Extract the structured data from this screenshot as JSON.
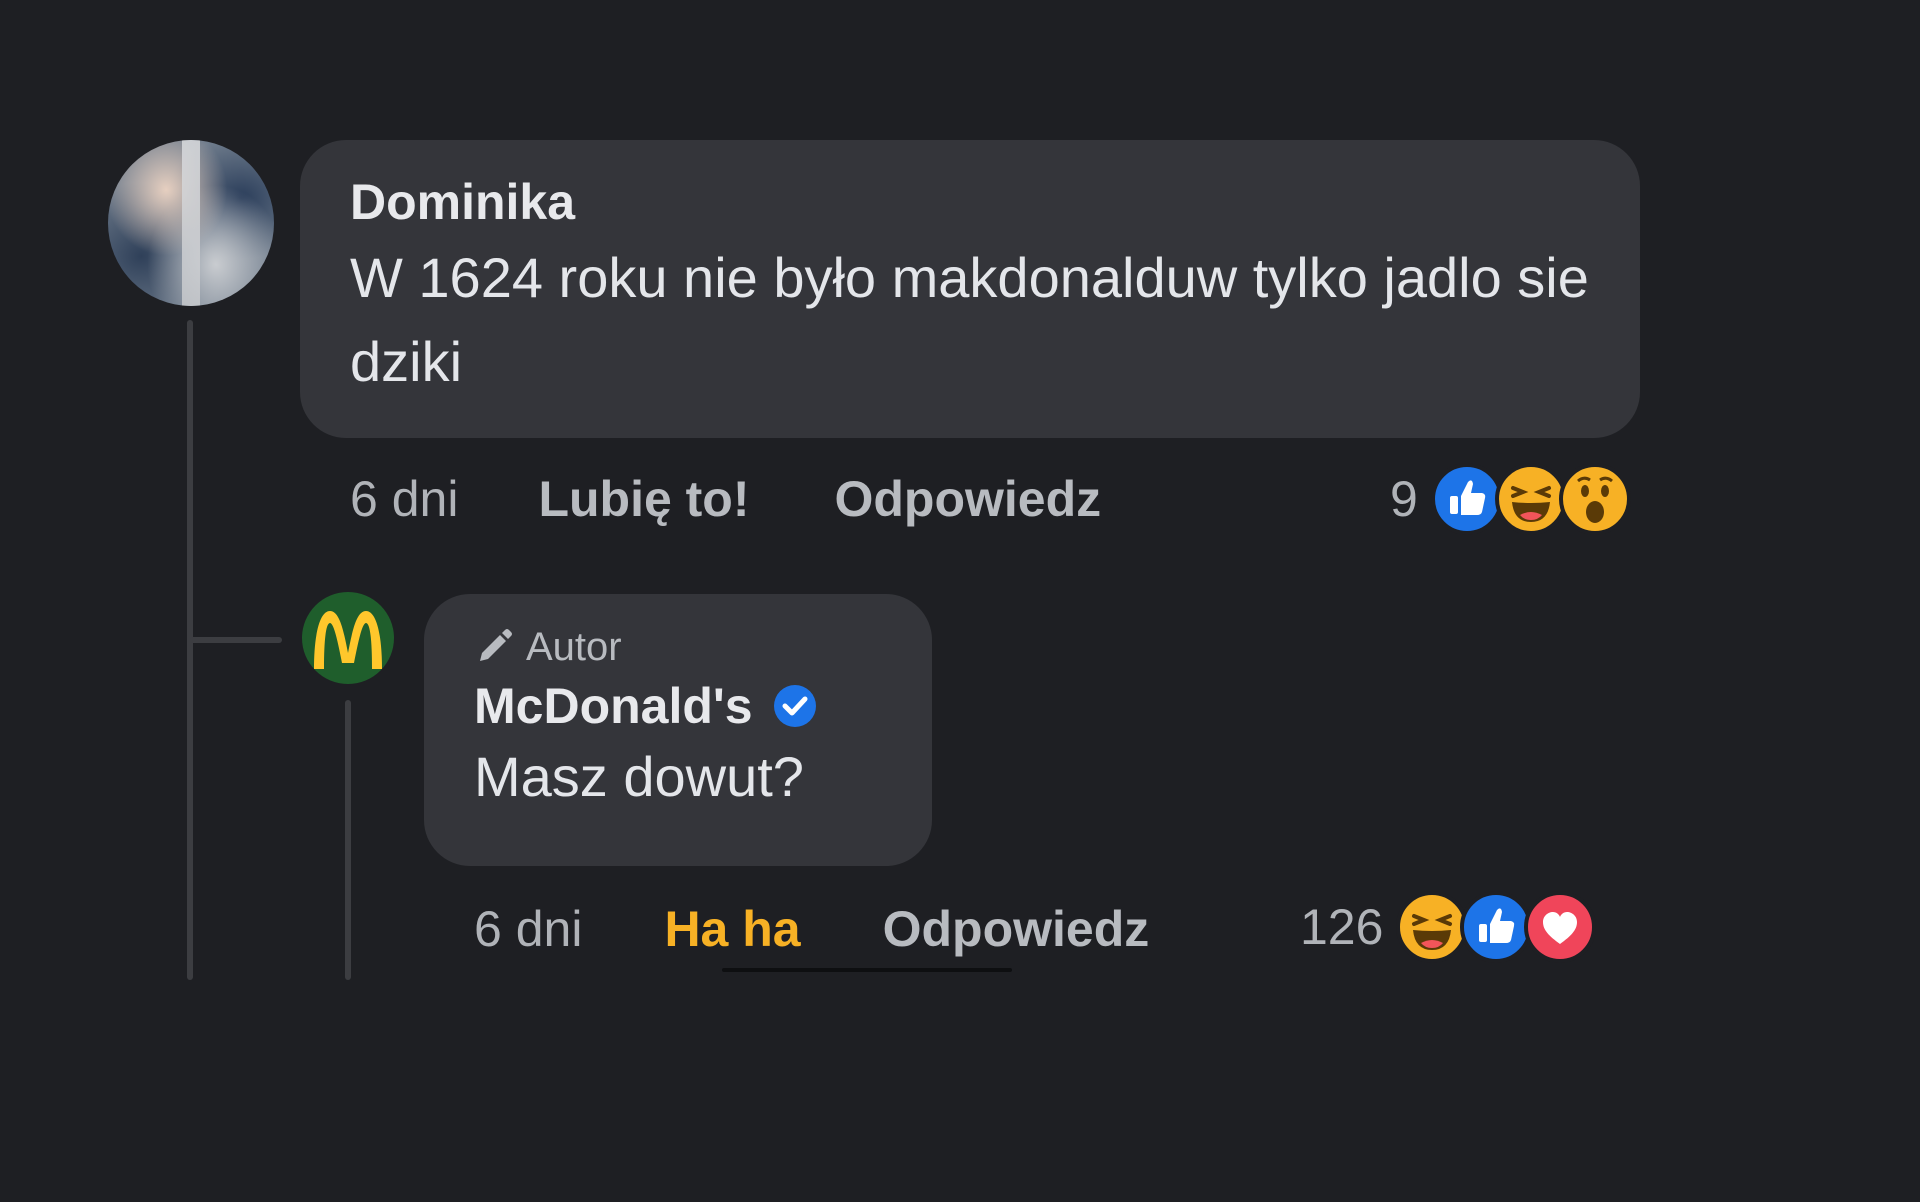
{
  "comment": {
    "author": "Dominika",
    "text": "W 1624 roku nie było makdonalduw tylko jadlo sie dziki",
    "time": "6 dni",
    "like_label": "Lubię to!",
    "reply_label": "Odpowiedz",
    "reaction_count": "9",
    "reaction_icons": [
      "like-icon",
      "haha-icon",
      "wow-icon"
    ]
  },
  "reply": {
    "badge": "Autor",
    "author": "McDonald's",
    "verified": true,
    "text": "Masz dowut?",
    "time": "6 dni",
    "reaction_label": "Ha ha",
    "reply_label": "Odpowiedz",
    "reaction_count": "126",
    "reaction_icons": [
      "haha-icon",
      "like-icon",
      "love-icon"
    ]
  },
  "colors": {
    "background": "#1e1f23",
    "bubble": "#34353a",
    "haha_active": "#f7b125",
    "verified_blue": "#1d74e8",
    "mcd_green": "#1f5e2c",
    "mcd_yellow": "#ffc72c"
  }
}
